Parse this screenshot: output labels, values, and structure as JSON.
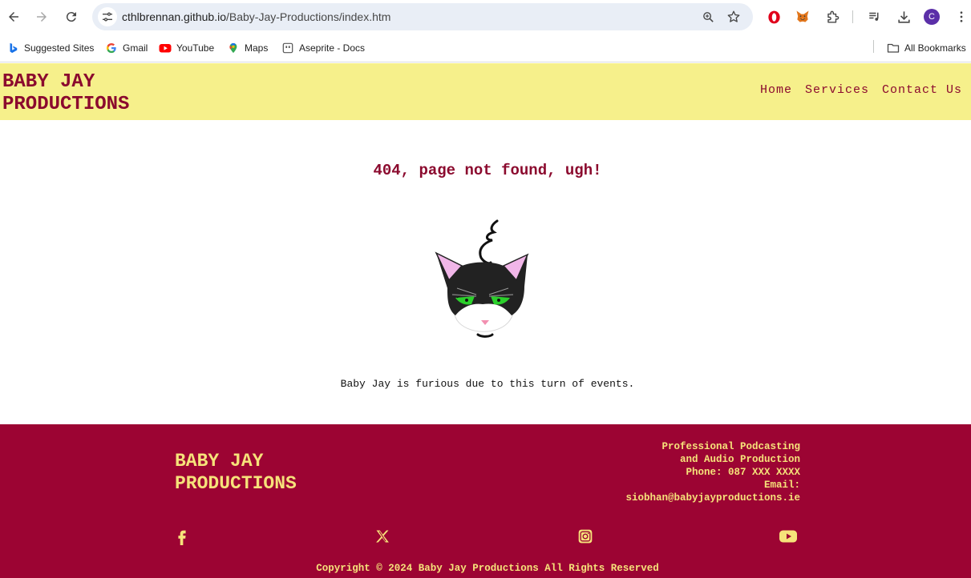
{
  "browser": {
    "url_host": "cthlbrennan.github.io",
    "url_path": "/Baby-Jay-Productions/index.htm",
    "profile_initial": "C",
    "icons": {
      "back": "back-arrow-icon",
      "forward": "forward-arrow-icon",
      "reload": "reload-icon",
      "site_info": "tune-icon",
      "zoom": "zoom-icon",
      "bookmark": "star-icon",
      "extensions": [
        "opera-icon",
        "metamask-fox-icon",
        "puzzle-icon",
        "media-queue-icon",
        "download-icon"
      ],
      "menu": "kebab-menu-icon"
    }
  },
  "bookmarks": {
    "items": [
      {
        "label": "Suggested Sites",
        "icon": "bing-icon"
      },
      {
        "label": "Gmail",
        "icon": "google-icon"
      },
      {
        "label": "YouTube",
        "icon": "youtube-icon"
      },
      {
        "label": "Maps",
        "icon": "maps-pin-icon"
      },
      {
        "label": "Aseprite - Docs",
        "icon": "aseprite-icon"
      }
    ],
    "all_bookmarks": "All Bookmarks"
  },
  "header": {
    "brand_line1": "BABY JAY",
    "brand_line2": "PRODUCTIONS",
    "nav": [
      "Home",
      "Services",
      "Contact Us"
    ]
  },
  "main": {
    "title": "404, page not found, ugh!",
    "image_icon": "angry-cat-illustration",
    "caption": "Baby Jay is furious due to this turn of events."
  },
  "footer": {
    "brand_line1": "BABY JAY",
    "brand_line2": "PRODUCTIONS",
    "info": [
      "Professional Podcasting",
      "and Audio Production",
      "Phone: 087 XXX XXXX",
      "Email:",
      "siobhan@babyjayproductions.ie"
    ],
    "social": [
      "facebook-icon",
      "x-icon",
      "instagram-icon",
      "youtube-icon"
    ],
    "copyright": "Copyright © 2024 Baby Jay Productions All Rights Reserved"
  },
  "colors": {
    "header_bg": "#f6f08b",
    "brand_red": "#8b0a2e",
    "footer_bg": "#9c0433",
    "footer_text": "#f6e27a"
  }
}
